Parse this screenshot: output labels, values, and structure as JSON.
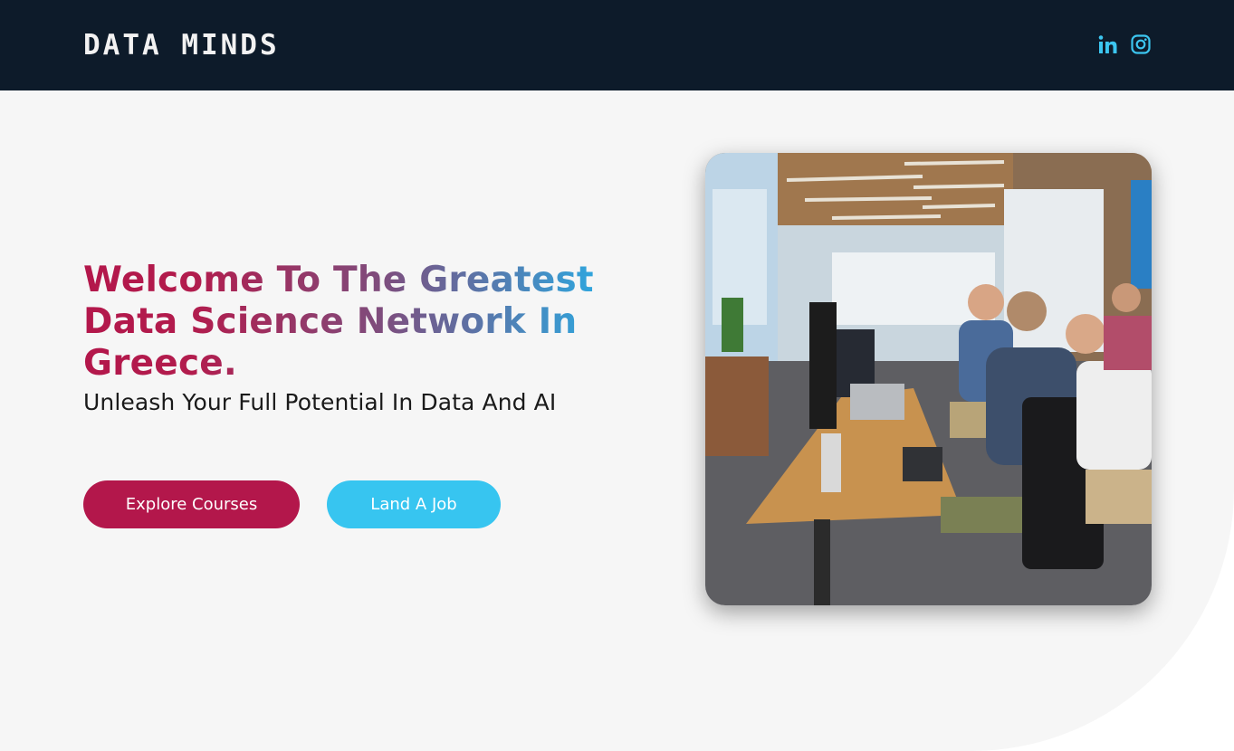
{
  "header": {
    "logo": "DATA MINDS",
    "social": [
      {
        "icon": "linkedin-icon",
        "label": "in"
      },
      {
        "icon": "instagram-icon"
      }
    ]
  },
  "hero": {
    "title": "Welcome To The Greatest Data Science Network In Greece.",
    "subtitle": "Unleash Your Full Potential In Data And AI",
    "buttons": {
      "explore": "Explore Courses",
      "job": "Land A Job"
    },
    "photo_icon": "office-photo"
  },
  "colors": {
    "header_bg": "#0d1b2a",
    "primary": "#b3174b",
    "accent": "#37c5f0",
    "hero_bg": "#f6f6f6"
  }
}
